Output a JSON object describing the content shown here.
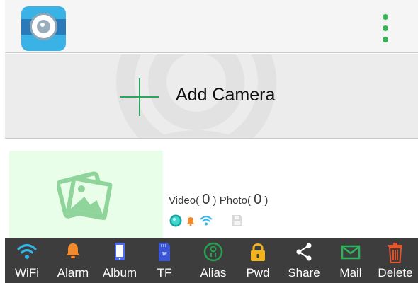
{
  "header": {
    "logo_icon": "camera-app-logo",
    "menu_icon": "vertical-dots-icon",
    "accent": "#35b35a"
  },
  "add_camera": {
    "label": "Add Camera",
    "icon": "plus-icon"
  },
  "camera": {
    "video_label": "Video",
    "video_count": "0",
    "photo_label": "Photo",
    "photo_count": "0",
    "status_icons": [
      "online-status-icon",
      "alarm-bell-icon",
      "wifi-icon",
      "sd-card-icon"
    ]
  },
  "toolbar": {
    "items": [
      {
        "label": "WiFi",
        "icon": "wifi-icon",
        "color": "#2fb7ec"
      },
      {
        "label": "Alarm",
        "icon": "bell-icon",
        "color": "#f38a2d"
      },
      {
        "label": "Album",
        "icon": "phone-album-icon",
        "color": "#4f6cf0"
      },
      {
        "label": "TF",
        "icon": "tf-card-icon",
        "color": "#3a55d6"
      },
      {
        "label": "Alias",
        "icon": "alias-user-icon",
        "color": "#25a04e"
      },
      {
        "label": "Pwd",
        "icon": "lock-icon",
        "color": "#f3b31c"
      },
      {
        "label": "Share",
        "icon": "share-icon",
        "color": "#ffffff"
      },
      {
        "label": "Mail",
        "icon": "mail-icon",
        "color": "#2fb35a"
      },
      {
        "label": "Delete",
        "icon": "trash-icon",
        "color": "#e8542c"
      }
    ]
  }
}
